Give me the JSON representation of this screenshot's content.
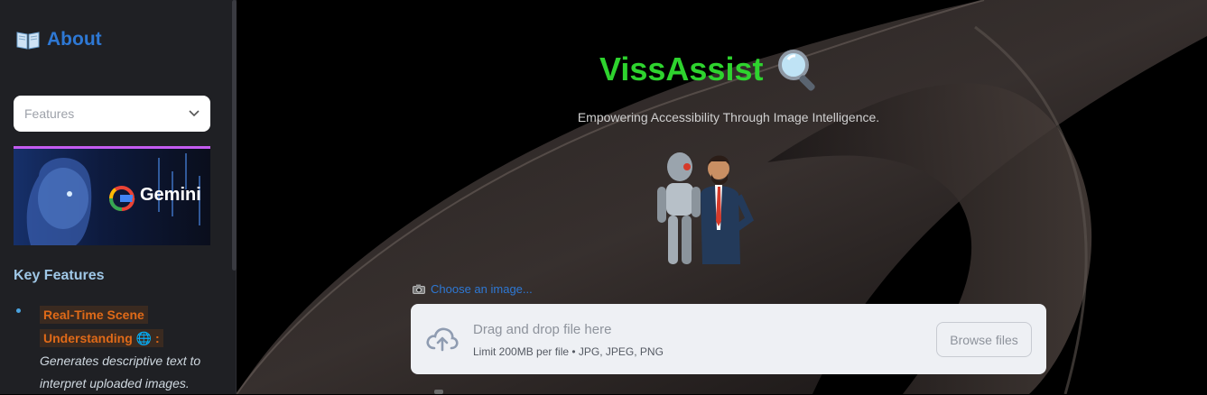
{
  "sidebar": {
    "about_heading": "About",
    "select": {
      "placeholder": "Features"
    },
    "banner": {
      "brand_text": "Gemini"
    },
    "key_features_heading": "Key Features",
    "features": [
      {
        "title_part1": "Real-Time Scene",
        "title_part2": "Understanding",
        "emoji": "🌐",
        "suffix": ":",
        "description": "Generates descriptive text to interpret uploaded images."
      }
    ]
  },
  "main": {
    "title": "VissAssist",
    "subtitle": "Empowering Accessibility Through Image Intelligence.",
    "uploader": {
      "label": "Choose an image...",
      "drag_text": "Drag and drop file here",
      "limit_text": "Limit 200MB per file • JPG, JPEG, PNG",
      "browse_label": "Browse files"
    }
  },
  "colors": {
    "title_green": "#2ed32e",
    "link_blue": "#2e78d4",
    "feature_orange": "#e06a18",
    "sidebar_bg": "#1f2024",
    "uploader_bg": "#eef0f4"
  },
  "icons": [
    "book-icon",
    "chevron-down-icon",
    "google-g-icon",
    "magnifier-icon",
    "camera-icon",
    "cloud-upload-icon",
    "globe-icon"
  ]
}
